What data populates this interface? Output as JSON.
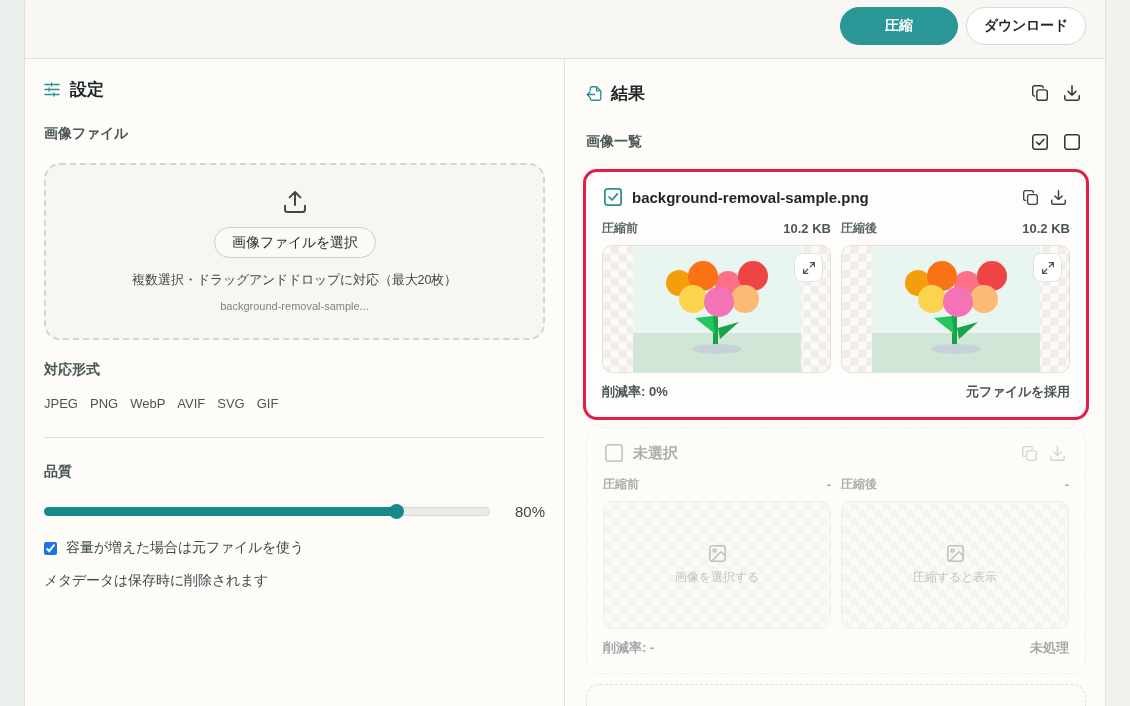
{
  "toolbar": {
    "buttons": [
      {
        "label": "圧縮",
        "kind": "primary"
      },
      {
        "label": "ダウンロード",
        "kind": "secondary"
      }
    ]
  },
  "settings": {
    "title": "設定",
    "file_label": "画像ファイル",
    "drop_zone": {
      "button": "画像ファイルを選択",
      "hint": "複数選択・ドラッグアンドドロップに対応（最大20枚）",
      "file_name": "background-removal-sample..."
    },
    "formats_label": "対応形式",
    "formats": [
      "JPEG",
      "PNG",
      "WebP",
      "AVIF",
      "SVG",
      "GIF"
    ],
    "quality": {
      "label": "品質",
      "level": 0.8,
      "reading": "80%"
    },
    "keep_original": {
      "label": "容量が増えた場合は元ファイルを使う",
      "checked": true
    },
    "note": "メタデータは保存時に削除されます"
  },
  "results": {
    "title": "結果",
    "list_label": "画像一覧",
    "files": [
      {
        "kind": "file",
        "name": "background-removal-sample.png",
        "checked": true,
        "highlighted": true,
        "disabled": false,
        "before": {
          "label": "圧縮前",
          "size": "10.2 KB",
          "kind": "image"
        },
        "after": {
          "label": "圧縮後",
          "size": "10.2 KB",
          "kind": "image"
        },
        "reduction": "削減率: 0%",
        "status": "元ファイルを採用"
      },
      {
        "kind": "file",
        "name": "未選択",
        "checked": false,
        "highlighted": false,
        "disabled": true,
        "before": {
          "label": "圧縮前",
          "size": "-",
          "kind": "empty",
          "message": "画像を選択する"
        },
        "after": {
          "label": "圧縮後",
          "size": "-",
          "kind": "empty",
          "message": "圧縮すると表示"
        },
        "reduction": "削減率: -",
        "status": "未処理"
      },
      {
        "kind": "cut"
      }
    ]
  }
}
